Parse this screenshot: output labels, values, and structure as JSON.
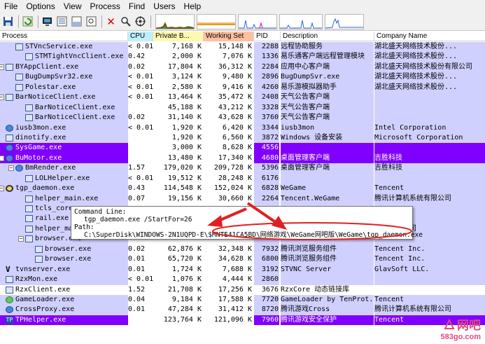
{
  "menu": [
    "File",
    "Options",
    "View",
    "Process",
    "Find",
    "Users",
    "Help"
  ],
  "toolbar": {
    "buttons": [
      "save-icon",
      "refresh-icon",
      "system-info-icon",
      "show-tree-icon",
      "show-lower-pane-icon",
      "find-window-icon",
      "kill-process-icon",
      "find-handle-icon",
      "target-icon"
    ]
  },
  "columns": {
    "process": "Process",
    "cpu": "CPU",
    "private": "Private B...",
    "working": "Working Set",
    "pid": "PID",
    "description": "Description",
    "company": "Company Name"
  },
  "rows": [
    {
      "name": "STVncService.exe",
      "cpu": "< 0.01",
      "priv": "7,168 K",
      "ws": "15,148 K",
      "pid": "2288",
      "desc": "远程协助服务",
      "comp": "湖北盛天网络技术股份..."
    },
    {
      "name": "STMTightVncClient.exe",
      "cpu": "0.42",
      "priv": "2,000 K",
      "ws": "7,076 K",
      "pid": "1336",
      "desc": "易乐通客户端远程管理模块",
      "comp": "湖北盛天网络技术股份..."
    },
    {
      "name": "BYAppClient.exe",
      "cpu": "0.02",
      "priv": "17,804 K",
      "ws": "36,312 K",
      "pid": "2284",
      "desc": "应用中心客户端",
      "comp": "湖北盛天网络技术股份有限公司"
    },
    {
      "name": "BugDumpSvr32.exe",
      "cpu": "< 0.01",
      "priv": "3,124 K",
      "ws": "9,480 K",
      "pid": "2896",
      "desc": "BugDumpSvr.exe",
      "comp": "湖北盛天网络技术股份..."
    },
    {
      "name": "Polestar.exe",
      "cpu": "< 0.01",
      "priv": "2,580 K",
      "ws": "9,416 K",
      "pid": "4260",
      "desc": "易乐游模拟器助手",
      "comp": "湖北盛天网络技术股份..."
    },
    {
      "name": "BarNoticeClient.exe",
      "cpu": "< 0.01",
      "priv": "13,464 K",
      "ws": "35,472 K",
      "pid": "2408",
      "desc": "天气公告客户端",
      "comp": ""
    },
    {
      "name": "BarNoticeClient.exe",
      "cpu": "",
      "priv": "45,188 K",
      "ws": "43,212 K",
      "pid": "3328",
      "desc": "天气公告客户端",
      "comp": ""
    },
    {
      "name": "BarNoticeClient.exe",
      "cpu": "0.02",
      "priv": "31,140 K",
      "ws": "43,628 K",
      "pid": "3760",
      "desc": "天气公告客户端",
      "comp": ""
    },
    {
      "name": "iusb3mon.exe",
      "cpu": "< 0.01",
      "priv": "1,920 K",
      "ws": "6,420 K",
      "pid": "3344",
      "desc": "iusb3mon",
      "comp": "Intel Corporation"
    },
    {
      "name": "dinotify.exe",
      "cpu": "",
      "priv": "1,920 K",
      "ws": "6,560 K",
      "pid": "3872",
      "desc": "Windows 设备安装",
      "comp": "Microsoft Corporation"
    },
    {
      "name": "SysGame.exe",
      "cpu": "",
      "priv": "3,000 K",
      "ws": "8,628 K",
      "pid": "4556",
      "desc": "",
      "comp": ""
    },
    {
      "name": "BuMotor.exe",
      "cpu": "",
      "priv": "13,480 K",
      "ws": "17,340 K",
      "pid": "4680",
      "desc": "桌面管理客户端",
      "comp": "吉胜科技"
    },
    {
      "name": "BmRender.exe",
      "cpu": "1.57",
      "priv": "179,020 K",
      "ws": "209,728 K",
      "pid": "5396",
      "desc": "桌面管理客户端",
      "comp": "吉胜科技"
    },
    {
      "name": "LOLHelper.exe",
      "cpu": "< 0.01",
      "priv": "19,512 K",
      "ws": "28,248 K",
      "pid": "6176",
      "desc": "",
      "comp": ""
    },
    {
      "name": "tgp_daemon.exe",
      "cpu": "0.43",
      "priv": "114,548 K",
      "ws": "152,024 K",
      "pid": "6828",
      "desc": "WeGame",
      "comp": "Tencent"
    },
    {
      "name": "helper_main.exe",
      "cpu": "0.07",
      "priv": "19,156 K",
      "ws": "30,660 K",
      "pid": "2264",
      "desc": "Tencent.WeGame",
      "comp": "腾讯计算机系统有限公司"
    },
    {
      "name": "tcls_core.exe",
      "cpu": "",
      "priv": "",
      "ws": "",
      "pid": "",
      "desc": "",
      "comp": ""
    },
    {
      "name": "rail.exe",
      "cpu": "",
      "priv": "",
      "ws": "",
      "pid": "",
      "desc": "",
      "comp": ""
    },
    {
      "name": "helper_main.exe",
      "cpu": "",
      "priv": "",
      "ws": "",
      "pid": "",
      "desc": "",
      "comp": "技术有限公司"
    },
    {
      "name": "browser.exe",
      "cpu": "",
      "priv": "",
      "ws": "",
      "pid": "",
      "desc": "",
      "comp": ""
    },
    {
      "name": "browser.exe",
      "cpu": "0.02",
      "priv": "62,876 K",
      "ws": "32,348 K",
      "pid": "7932",
      "desc": "腾讯浏览服务组件",
      "comp": "Tencent Inc."
    },
    {
      "name": "browser.exe",
      "cpu": "0.01",
      "priv": "65,720 K",
      "ws": "34,628 K",
      "pid": "6800",
      "desc": "腾讯浏览服务组件",
      "comp": "Tencent Inc."
    },
    {
      "name": "tvnserver.exe",
      "cpu": "0.01",
      "priv": "1,724 K",
      "ws": "7,688 K",
      "pid": "3192",
      "desc": "STVNC Server",
      "comp": "GlavSoft LLC."
    },
    {
      "name": "RzxMon.exe",
      "cpu": "< 0.01",
      "priv": "1,076 K",
      "ws": "4,444 K",
      "pid": "2860",
      "desc": "",
      "comp": ""
    },
    {
      "name": "RzxClient.exe",
      "cpu": "1.52",
      "priv": "21,708 K",
      "ws": "17,256 K",
      "pid": "3676",
      "desc": "RzxCore 动态链接库",
      "comp": ""
    },
    {
      "name": "GameLoader.exe",
      "cpu": "0.04",
      "priv": "9,184 K",
      "ws": "17,588 K",
      "pid": "7720",
      "desc": "GameLoader by TenProt...",
      "comp": "Tencent"
    },
    {
      "name": "CrossProxy.exe",
      "cpu": "0.01",
      "priv": "47,284 K",
      "ws": "31,412 K",
      "pid": "8720",
      "desc": "腾讯游戏Cross",
      "comp": "腾讯计算机系统有限公司"
    },
    {
      "name": "TPHelper.exe",
      "cpu": "0.08",
      "priv": "123,764 K",
      "ws": "121,096 K",
      "pid": "7960",
      "desc": "腾讯游戏安全保护",
      "comp": "Tencent"
    }
  ],
  "tooltip": {
    "label1": "Command Line:",
    "line1": "tgp_daemon.exe  /StartFor=26",
    "label2": "Path:",
    "line2": "C:\\SuperDisk\\WINDOWS-2N1UQPD-E\\$MNTE41CA5BD\\网络游戏\\WeGame网吧版\\WeGame\\tgp_daemon.exe"
  },
  "watermark": {
    "brand": "网吧",
    "site": "583go.com"
  },
  "colors": {
    "service_row": "#d0d0ff",
    "highlight_row": "#8000ff",
    "cpu_header": "#bfefff",
    "priv_header": "#fff8b0",
    "ws_header": "#ffc0a0",
    "annotation_red": "#e02020"
  }
}
